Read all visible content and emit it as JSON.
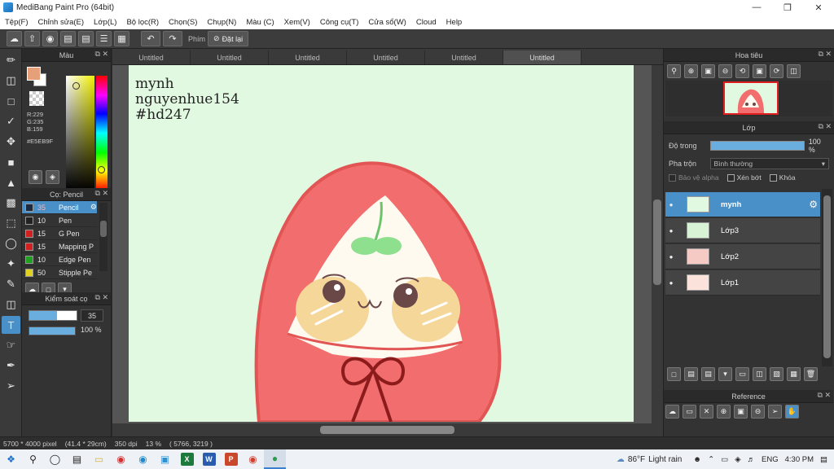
{
  "window": {
    "title": "MediBang Paint Pro (64bit)"
  },
  "menu": [
    "Tệp(F)",
    "Chỉnh sửa(E)",
    "Lớp(L)",
    "Bộ lọc(R)",
    "Chọn(S)",
    "Chụp(N)",
    "Màu (C)",
    "Xem(V)",
    "Công cụ(T)",
    "Cửa sổ(W)",
    "Cloud",
    "Help"
  ],
  "toolbar": {
    "shortcut_label": "Phím",
    "reset_label": "Đặt lại"
  },
  "color_panel": {
    "title": "Màu",
    "r": "R:229",
    "g": "G:235",
    "b": "B:159",
    "hex": "#E5EB9F",
    "fg_color": "#e5a07a"
  },
  "brush_panel": {
    "title": "Cọ: Pencil",
    "brushes": [
      {
        "size": "35",
        "name": "Pencil",
        "color": "#1c2a40",
        "selected": true
      },
      {
        "size": "10",
        "name": "Pen",
        "color": "#222222"
      },
      {
        "size": "15",
        "name": "G Pen",
        "color": "#d02020"
      },
      {
        "size": "15",
        "name": "Mapping P",
        "color": "#d02020"
      },
      {
        "size": "10",
        "name": "Edge Pen",
        "color": "#20a020"
      },
      {
        "size": "50",
        "name": "Stipple Pe",
        "color": "#e0d020"
      }
    ]
  },
  "brush_control": {
    "title": "Kiểm soát cọ",
    "size_value": "35",
    "size_fraction": 0.58,
    "opacity_value": "100 %"
  },
  "tabs": [
    "Untitled",
    "Untitled",
    "Untitled",
    "Untitled",
    "Untitled",
    "Untitled"
  ],
  "active_tab": 5,
  "canvas": {
    "line1": "mynh",
    "line2": "nguyenhue154",
    "line3": "#hd247"
  },
  "navigator": {
    "title": "Hoa tiêu"
  },
  "layer_panel": {
    "title": "Lớp",
    "opacity_label": "Độ trong",
    "opacity_value": "100 %",
    "blend_label": "Pha trộn",
    "blend_value": "Bình thường",
    "protect_alpha": "Bảo vệ alpha",
    "clipping": "Xén bớt",
    "lock": "Khóa",
    "layers": [
      {
        "name": "mynh",
        "selected": true
      },
      {
        "name": "Lớp3"
      },
      {
        "name": "Lớp2"
      },
      {
        "name": "Lớp1"
      }
    ]
  },
  "reference_panel": {
    "title": "Reference"
  },
  "status": {
    "size": "5700 * 4000 pixel",
    "physical": "(41.4 * 29cm)",
    "dpi": "350 dpi",
    "zoom": "13 %",
    "coords": "( 5766, 3219 )"
  },
  "taskbar": {
    "temperature": "86°F",
    "weather": "Light rain",
    "lang": "ENG",
    "time": "4:30 PM"
  }
}
